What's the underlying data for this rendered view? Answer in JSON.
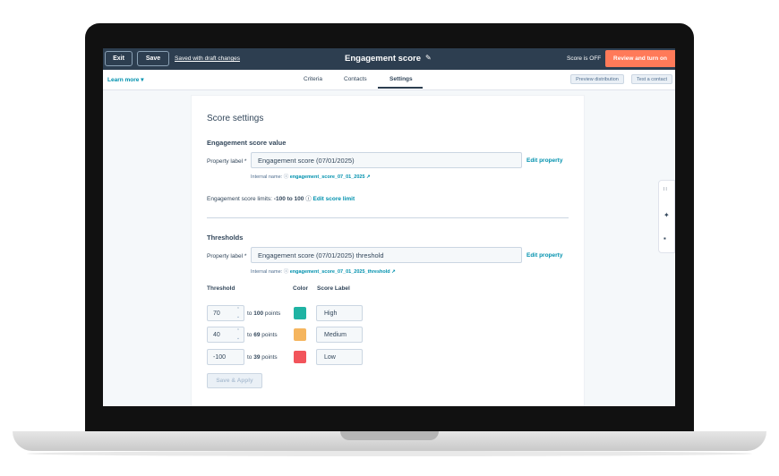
{
  "topbar": {
    "exit_label": "Exit",
    "save_label": "Save",
    "saved_status": "Saved with draft changes",
    "title": "Engagement score",
    "edit_icon": "pencil-icon",
    "score_status": "Score is OFF",
    "review_label": "Review and turn on"
  },
  "tabbar": {
    "learn_more": "Learn more ▾",
    "tabs": [
      "Criteria",
      "Contacts",
      "Settings"
    ],
    "active_tab": "Settings",
    "preview_label": "Preview distribution",
    "test_label": "Test a contact"
  },
  "settings": {
    "heading": "Score settings",
    "value_section": {
      "heading": "Engagement score value",
      "property_label": "Property label *",
      "property_value": "Engagement score (07/01/2025)",
      "edit_property": "Edit property",
      "internal_name_label": "Internal name:",
      "internal_name": "engagement_score_07_01_2025 ↗",
      "limits_label": "Engagement score limits:",
      "limits_value": "-100 to 100",
      "edit_limit": "Edit score limit"
    },
    "threshold_section": {
      "heading": "Thresholds",
      "property_label": "Property label *",
      "property_value": "Engagement score (07/01/2025) threshold",
      "edit_property": "Edit property",
      "internal_name_label": "Internal name:",
      "internal_name": "engagement_score_07_01_2025_threshold ↗",
      "columns": [
        "Threshold",
        "Color",
        "Score Label"
      ],
      "rows": [
        {
          "from": "70",
          "to_prefix": "to",
          "to": "100",
          "to_suffix": "points",
          "color": "#1fb3a3",
          "label": "High"
        },
        {
          "from": "40",
          "to_prefix": "to",
          "to": "69",
          "to_suffix": "points",
          "color": "#f5b55e",
          "label": "Medium"
        },
        {
          "from": "-100",
          "to_prefix": "to",
          "to": "39",
          "to_suffix": "points",
          "color": "#f2545b",
          "label": "Low"
        }
      ]
    },
    "save_apply": "Save & Apply"
  },
  "colors": {
    "topbar": "#2d3e50",
    "accent": "#ff7a59",
    "link": "#0091ae"
  },
  "side_rail_icons": [
    "grid-icon",
    "sparkle-icon",
    "chat-icon"
  ]
}
